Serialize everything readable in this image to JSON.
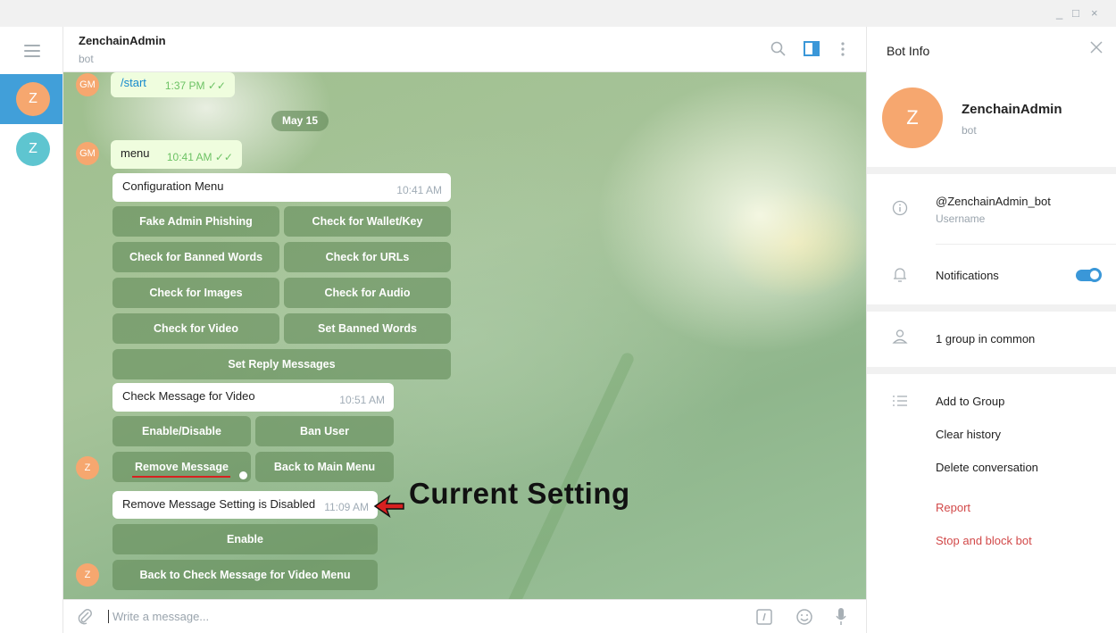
{
  "window": {
    "min": "_",
    "max": "□",
    "close": "×"
  },
  "chats": [
    {
      "initial": "Z",
      "color": "#f6a76f"
    },
    {
      "initial": "Z",
      "color": "#5ec5d0"
    }
  ],
  "header": {
    "name": "ZenchainAdmin",
    "status": "bot"
  },
  "messages": {
    "start": {
      "avatar": "GM",
      "text": "/start",
      "time": "1:37 PM"
    },
    "date": "May 15",
    "menu": {
      "avatar": "GM",
      "text": "menu",
      "time": "10:41 AM"
    },
    "config": {
      "text": "Configuration Menu",
      "time": "10:41 AM"
    },
    "config_buttons": [
      "Fake Admin Phishing",
      "Check for Wallet/Key",
      "Check for Banned Words",
      "Check for URLs",
      "Check for Images",
      "Check for Audio",
      "Check for Video",
      "Set Banned Words",
      "Set Reply Messages"
    ],
    "video": {
      "text": "Check Message for Video",
      "time": "10:51 AM"
    },
    "video_buttons": [
      "Enable/Disable",
      "Ban User",
      "Remove Message",
      "Back to Main Menu"
    ],
    "remove": {
      "text": "Remove Message Setting is Disabled",
      "time": "11:09 AM"
    },
    "remove_buttons": [
      "Enable",
      "Back to Check Message for Video Menu"
    ],
    "bot_avatar": "Z"
  },
  "annotation": "Current Setting",
  "input": {
    "placeholder": "Write a message..."
  },
  "panel": {
    "title": "Bot Info",
    "initial": "Z",
    "name": "ZenchainAdmin",
    "sub": "bot",
    "username": "@ZenchainAdmin_bot",
    "username_label": "Username",
    "notifications": "Notifications",
    "notifications_on": true,
    "groups": "1 group in common",
    "add_to_group": "Add to Group",
    "clear_history": "Clear history",
    "delete_conversation": "Delete conversation",
    "report": "Report",
    "stop_block": "Stop and block bot"
  },
  "colors": {
    "accent": "#419fd9",
    "avatar_orange": "#f6a76f",
    "danger": "#d24949"
  }
}
